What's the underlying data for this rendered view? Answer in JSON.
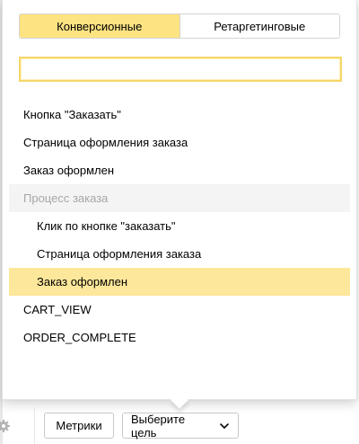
{
  "tabs": {
    "conversion_label": "Конверсионные",
    "retargeting_label": "Ретаргетинговые"
  },
  "search": {
    "value": "",
    "placeholder": ""
  },
  "goals": {
    "items": [
      {
        "label": "Кнопка \"Заказать\""
      },
      {
        "label": "Страница оформления заказа"
      },
      {
        "label": "Заказ оформлен"
      },
      {
        "label": "Процесс заказа"
      },
      {
        "label": "Клик по кнопке \"заказать\""
      },
      {
        "label": "Страница оформления заказа"
      },
      {
        "label": "Заказ оформлен"
      },
      {
        "label": "CART_VIEW"
      },
      {
        "label": "ORDER_COMPLETE"
      }
    ]
  },
  "footer": {
    "metrics_label": "Метрики",
    "goal_label": "Выберите цель"
  },
  "icons": {
    "settings": "gear-icon",
    "dropdown": "chevron-down-icon"
  },
  "colors": {
    "accent": "#fde382",
    "selected_row": "#fde79a",
    "search_border": "#f5d66a",
    "group_text": "#a6a6a6"
  }
}
